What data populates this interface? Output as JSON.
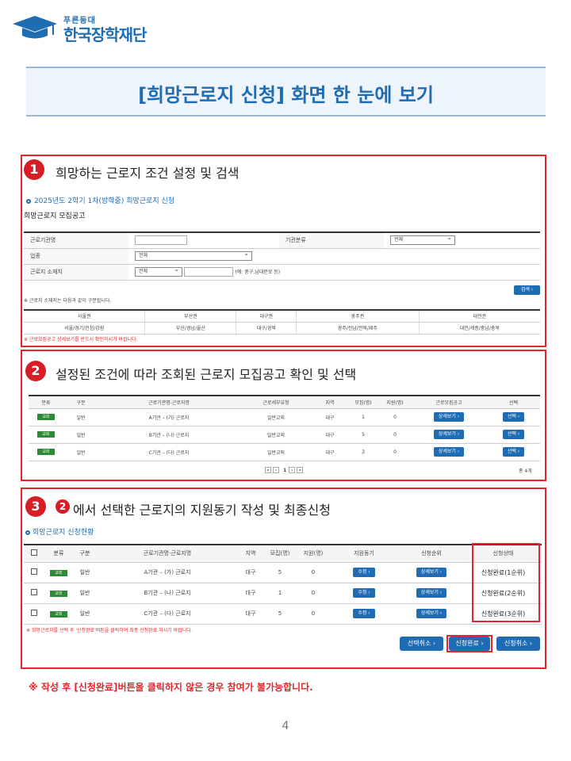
{
  "logo": {
    "slogan": "푸른등대",
    "name": "한국장학재단"
  },
  "title": "[희망근로지 신청] 화면 한 눈에 보기",
  "step1": {
    "number": "1",
    "heading": "희망하는 근로지 조건 설정 및 검색",
    "semester": "2025년도 2학기 1차(방학중) 희망근로지 신청",
    "board": "희망근로지 모집공고",
    "labels": {
      "org": "근로기관명",
      "category": "기관분류",
      "industry": "업종",
      "location": "근로지 소재지"
    },
    "category_value": "전체",
    "industry_value": "전체",
    "location_value": "전체",
    "location_hint": "(예: 중구,남대문로 등)",
    "search_label": "검색",
    "region_note": "※ 근로지 소재지는 다음과 같이 구분됩니다.",
    "regions_head": [
      "서울권",
      "부산권",
      "대구권",
      "광주권",
      "대전권"
    ],
    "regions_body": [
      "서울/경기/인천/강원",
      "부산/경남/울산",
      "대구/경북",
      "광주/전남/전북/제주",
      "대전/세종/충남/충북"
    ],
    "detail_note": "※ 근로모집공고 상세보기를 반드시 확인하시기 바랍니다."
  },
  "step2": {
    "number": "2",
    "heading": "설정된 조건에 따라 조회된 근로지 모집공고 확인 및 선택",
    "columns": [
      "분류",
      "구분",
      "근로기관명-근로지명",
      "근로세부유형",
      "지역",
      "모집(명)",
      "지원(명)",
      "근로모집공고",
      "선택"
    ],
    "rows": [
      {
        "badge": "교외",
        "type": "일반",
        "name": "A기관 – (가) 근로지",
        "detail": "일반교외",
        "region": "대구",
        "recruit": "1",
        "applied": "0",
        "view": "상세보기",
        "select": "선택"
      },
      {
        "badge": "교외",
        "type": "일반",
        "name": "B기관 – (나) 근로지",
        "detail": "일반교외",
        "region": "대구",
        "recruit": "5",
        "applied": "0",
        "view": "상세보기",
        "select": "선택"
      },
      {
        "badge": "교외",
        "type": "일반",
        "name": "C기관 – (다) 근로지",
        "detail": "일반교외",
        "region": "대구",
        "recruit": "3",
        "applied": "0",
        "view": "상세보기",
        "select": "선택"
      }
    ],
    "pager": {
      "first": "«",
      "prev": "‹",
      "page": "1",
      "next": "›",
      "last": "»"
    },
    "total": "총 4개"
  },
  "step3": {
    "number": "3",
    "ref_number": "2",
    "heading": "에서 선택한 근로지의 지원동기 작성 및 최종신청",
    "sub": "희망근로지 신청현황",
    "columns": [
      "분류",
      "구분",
      "근로기관명-근로지명",
      "지역",
      "모집(명)",
      "지원(명)",
      "지원동기",
      "신청순위",
      "신청상태"
    ],
    "rows": [
      {
        "badge": "교외",
        "type": "일반",
        "name": "A기관 – (가) 근로지",
        "region": "대구",
        "recruit": "5",
        "applied": "0",
        "edit": "수정",
        "view": "상세보기",
        "status": "신청완료(1순위)"
      },
      {
        "badge": "교외",
        "type": "일반",
        "name": "B기관 – (나) 근로지",
        "region": "대구",
        "recruit": "1",
        "applied": "0",
        "edit": "수정",
        "view": "상세보기",
        "status": "신청완료(2순위)"
      },
      {
        "badge": "교외",
        "type": "일반",
        "name": "C기관 – (다) 근로지",
        "region": "대구",
        "recruit": "5",
        "applied": "0",
        "edit": "수정",
        "view": "상세보기",
        "status": "신청완료(3순위)"
      }
    ],
    "note": "※ 희망근로지를 선택 후 '신청완료'버튼을 클릭하여 최종 신청완료 하시기 바랍니다.",
    "btn_cancel_select": "선택취소",
    "btn_complete": "신청완료",
    "btn_cancel_apply": "신청취소"
  },
  "warning": "※ 작성 후 [신청완료]버튼을 클릭하지 않은 경우 참여가 불가능합니다.",
  "page_number": "4"
}
